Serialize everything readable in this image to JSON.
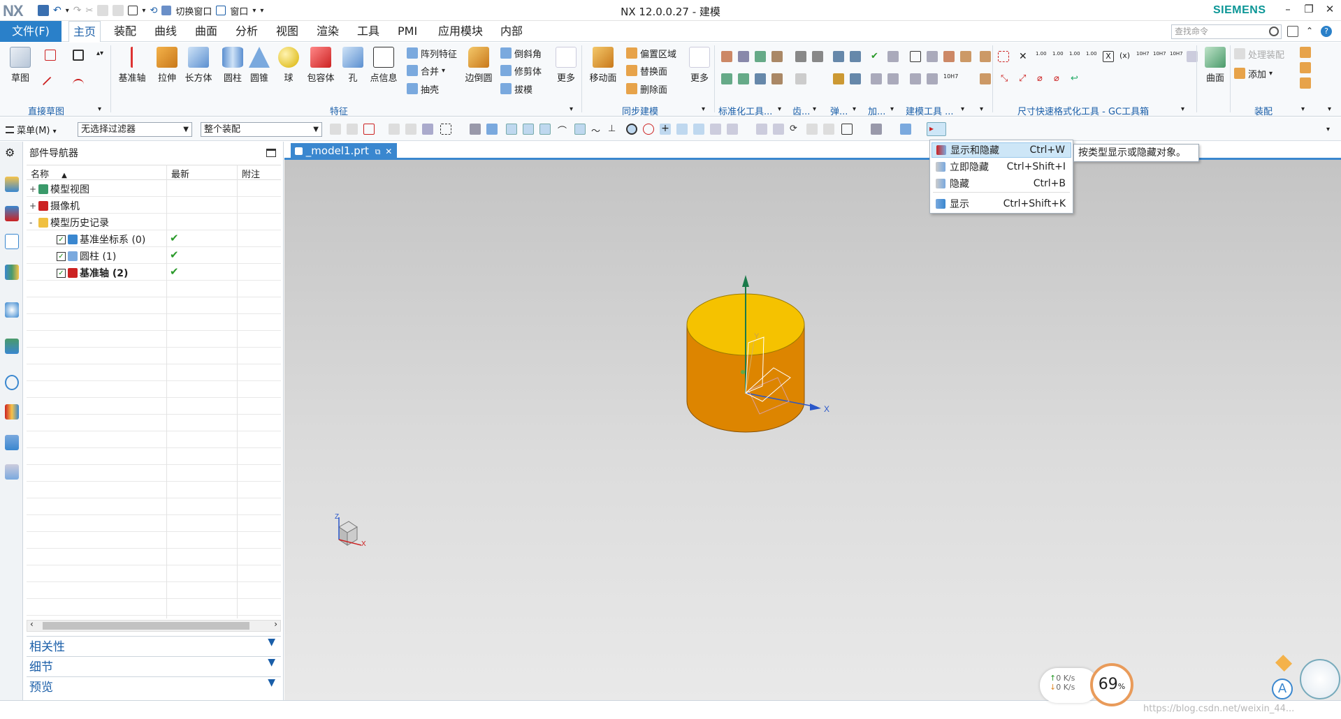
{
  "app": {
    "logo": "NX",
    "title": "NX 12.0.0.27 - 建模",
    "brand": "SIEMENS"
  },
  "qat": {
    "switch_window": "切换窗口",
    "window_menu": "窗口"
  },
  "menubar": {
    "file": "文件(F)",
    "tabs": [
      "主页",
      "装配",
      "曲线",
      "曲面",
      "分析",
      "视图",
      "渲染",
      "工具",
      "PMI",
      "应用模块",
      "内部"
    ],
    "active_tab": "主页",
    "search_placeholder": "查找命令"
  },
  "ribbon": {
    "sketch": "草图",
    "direct_sketch": "直接草图",
    "datum_axis": "基准轴",
    "extrude": "拉伸",
    "block": "长方体",
    "cylinder": "圆柱",
    "cone": "圆锥",
    "sphere": "球",
    "bounding_body": "包容体",
    "hole": "孔",
    "point_info": "点信息",
    "pattern_feature": "阵列特征",
    "unite": "合并",
    "shell": "抽壳",
    "edge_blend": "边倒圆",
    "chamfer": "倒斜角",
    "trim_body": "修剪体",
    "draft": "拔模",
    "more1": "更多",
    "feature_group": "特征",
    "move_face": "移动面",
    "offset_region": "偏置区域",
    "replace_face": "替换面",
    "delete_face": "删除面",
    "more2": "更多",
    "sync_modeling": "同步建模",
    "standard_tools": "标准化工具...",
    "gear": "齿...",
    "spring": "弹...",
    "add": "加...",
    "modeling_tools": "建模工具 ...",
    "dim_format_tools": "尺寸快速格式化工具 - GC工具箱",
    "surface": "曲面",
    "process_assembly": "处理装配",
    "add_component": "添加",
    "assembly": "装配"
  },
  "toolbar": {
    "menu": "菜单(M)",
    "filter": "无选择过滤器",
    "scope": "整个装配"
  },
  "navigator": {
    "title": "部件导航器",
    "columns": [
      "名称",
      "最新",
      "附注"
    ],
    "nodes": [
      {
        "label": "模型视图",
        "expander": "+",
        "checked": null,
        "latest": ""
      },
      {
        "label": "摄像机",
        "expander": "+",
        "checked": null,
        "latest": ""
      },
      {
        "label": "模型历史记录",
        "expander": "-",
        "checked": null,
        "latest": ""
      },
      {
        "label": "基准坐标系 (0)",
        "expander": "",
        "checked": true,
        "latest": "✔"
      },
      {
        "label": "圆柱 (1)",
        "expander": "",
        "checked": true,
        "latest": "✔"
      },
      {
        "label": "基准轴 (2)",
        "expander": "",
        "checked": true,
        "latest": "✔"
      }
    ],
    "sections": [
      "相关性",
      "细节",
      "预览"
    ]
  },
  "viewport": {
    "tab": "_model1.prt",
    "axis_x": "X",
    "axis_y": "Y",
    "triad_x": "X",
    "triad_z": "Z"
  },
  "popup_menu": {
    "items": [
      {
        "label": "显示和隐藏",
        "shortcut": "Ctrl+W",
        "highlighted": true
      },
      {
        "label": "立即隐藏",
        "shortcut": "Ctrl+Shift+I",
        "highlighted": false
      },
      {
        "label": "隐藏",
        "shortcut": "Ctrl+B",
        "highlighted": false
      },
      {
        "label": "显示",
        "shortcut": "Ctrl+Shift+K",
        "highlighted": false
      }
    ],
    "tooltip": "按类型显示或隐藏对象。"
  },
  "overlay": {
    "up_speed": "0  K/s",
    "down_speed": "0  K/s",
    "gauge_value": "69",
    "gauge_unit": "%",
    "watermark": "https://blog.csdn.net/weixin_44..."
  },
  "colors": {
    "accent": "#2a80c9",
    "cylinder_top": "#f5c200",
    "cylinder_side": "#d98300"
  }
}
